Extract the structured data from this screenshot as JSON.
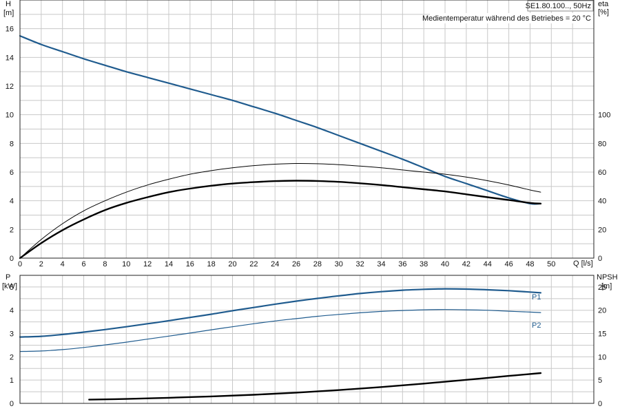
{
  "chart_data": [
    {
      "type": "line",
      "id": "top",
      "title_box": "SE1.80.100.., 50Hz",
      "annotation": "Medientemperatur während des Betriebes = 20 °C",
      "y_left": {
        "label": "H",
        "unit": "[m]",
        "lim": [
          0,
          18
        ],
        "ticks": [
          0,
          2,
          4,
          6,
          8,
          10,
          12,
          14,
          16
        ]
      },
      "y_right": {
        "label": "eta",
        "unit": "[%]",
        "lim": [
          0,
          180
        ],
        "ticks": [
          0,
          20,
          40,
          60,
          80,
          100
        ]
      },
      "x": {
        "label": "Q [l/s]",
        "lim": [
          0,
          54
        ],
        "ticks": [
          0,
          2,
          4,
          6,
          8,
          10,
          12,
          14,
          16,
          18,
          20,
          22,
          24,
          26,
          28,
          30,
          32,
          34,
          36,
          38,
          40,
          42,
          44,
          46,
          48,
          50
        ]
      },
      "grid": true,
      "series": [
        {
          "color": "#1f5b8e",
          "width": 2.2,
          "axis": "left",
          "x": [
            0,
            2,
            4,
            6,
            8,
            10,
            12,
            14,
            16,
            18,
            20,
            22,
            24,
            26,
            28,
            30,
            32,
            34,
            36,
            38,
            40,
            42,
            44,
            46,
            48,
            49
          ],
          "y": [
            15.5,
            14.9,
            14.4,
            13.9,
            13.45,
            13.0,
            12.6,
            12.2,
            11.8,
            11.4,
            11.0,
            10.55,
            10.1,
            9.6,
            9.1,
            8.55,
            8.0,
            7.45,
            6.9,
            6.3,
            5.7,
            5.2,
            4.7,
            4.2,
            3.8,
            3.8
          ]
        },
        {
          "color": "#000000",
          "width": 1.0,
          "axis": "right",
          "x": [
            0,
            2,
            4,
            6,
            8,
            10,
            12,
            14,
            16,
            18,
            20,
            22,
            24,
            26,
            28,
            30,
            32,
            34,
            36,
            38,
            40,
            42,
            44,
            46,
            48,
            49
          ],
          "y": [
            0,
            13,
            24,
            33,
            40,
            46,
            51,
            55,
            58.5,
            61,
            63,
            64.5,
            65.5,
            66,
            65.8,
            65.2,
            64.2,
            63,
            61.5,
            60,
            58.5,
            56.5,
            54,
            51,
            47.5,
            46
          ]
        },
        {
          "color": "#000000",
          "width": 2.4,
          "axis": "right",
          "x": [
            0,
            2,
            4,
            6,
            8,
            10,
            12,
            14,
            16,
            18,
            20,
            22,
            24,
            26,
            28,
            30,
            32,
            34,
            36,
            38,
            40,
            42,
            44,
            46,
            48,
            49
          ],
          "y": [
            0,
            10.5,
            19.5,
            27,
            33.5,
            38.5,
            42.5,
            46,
            48.5,
            50.5,
            52,
            53,
            53.7,
            54,
            53.8,
            53.2,
            52.2,
            51,
            49.5,
            48,
            46.5,
            44.5,
            42.5,
            40.5,
            38.5,
            38
          ]
        }
      ]
    },
    {
      "type": "line",
      "id": "bottom",
      "y_left": {
        "label": "P",
        "unit": "[kW]",
        "lim": [
          0,
          5.5
        ],
        "ticks": [
          0,
          1,
          2,
          3,
          4,
          5
        ]
      },
      "y_right": {
        "label": "NPSH",
        "unit": "[m]",
        "lim": [
          0,
          27.5
        ],
        "ticks": [
          0,
          5,
          10,
          15,
          20,
          25
        ]
      },
      "x": {
        "lim": [
          0,
          54
        ]
      },
      "grid": true,
      "series": [
        {
          "name": "P1",
          "color": "#1f5b8e",
          "width": 2.2,
          "axis": "left",
          "x": [
            0,
            2,
            4,
            6,
            8,
            10,
            12,
            14,
            16,
            18,
            20,
            22,
            24,
            26,
            28,
            30,
            32,
            34,
            36,
            38,
            40,
            42,
            44,
            46,
            48,
            49
          ],
          "y": [
            2.85,
            2.88,
            2.96,
            3.06,
            3.17,
            3.29,
            3.42,
            3.55,
            3.69,
            3.83,
            3.98,
            4.12,
            4.26,
            4.39,
            4.51,
            4.62,
            4.72,
            4.8,
            4.86,
            4.9,
            4.92,
            4.91,
            4.88,
            4.84,
            4.78,
            4.75
          ]
        },
        {
          "name": "P2",
          "color": "#1f5b8e",
          "width": 1.2,
          "axis": "left",
          "x": [
            0,
            2,
            4,
            6,
            8,
            10,
            12,
            14,
            16,
            18,
            20,
            22,
            24,
            26,
            28,
            30,
            32,
            34,
            36,
            38,
            40,
            42,
            44,
            46,
            48,
            49
          ],
          "y": [
            2.23,
            2.25,
            2.31,
            2.4,
            2.51,
            2.63,
            2.76,
            2.89,
            3.02,
            3.16,
            3.29,
            3.42,
            3.54,
            3.64,
            3.74,
            3.82,
            3.89,
            3.95,
            3.99,
            4.02,
            4.03,
            4.02,
            4.0,
            3.96,
            3.92,
            3.9
          ]
        },
        {
          "color": "#000000",
          "width": 2.4,
          "axis": "right",
          "x": [
            6.5,
            10,
            14,
            18,
            22,
            26,
            30,
            34,
            38,
            42,
            46,
            49
          ],
          "y": [
            0.8,
            0.95,
            1.2,
            1.5,
            1.85,
            2.3,
            2.85,
            3.5,
            4.25,
            5.05,
            5.9,
            6.5
          ]
        }
      ]
    }
  ]
}
